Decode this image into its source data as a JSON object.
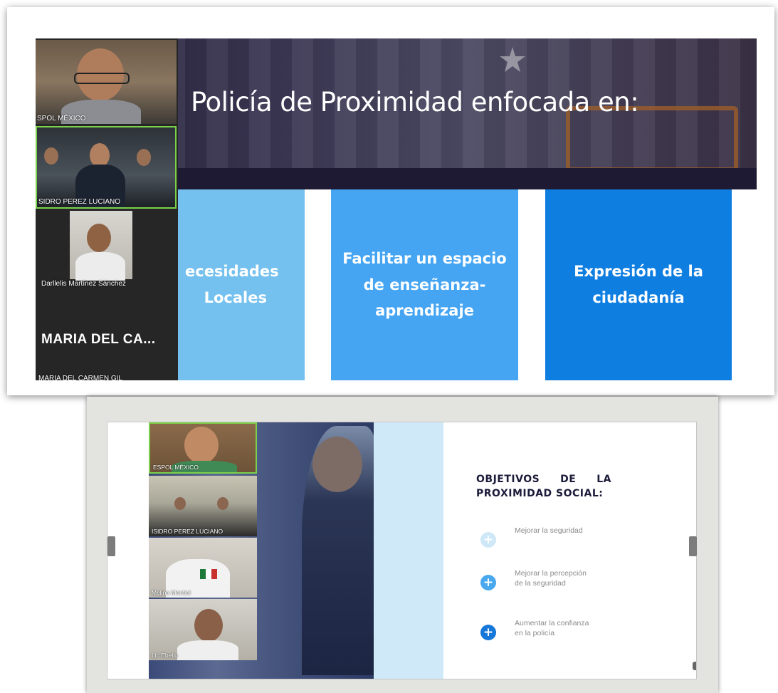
{
  "top_slide": {
    "title": "Policía de Proximidad enfocada en:",
    "cards": [
      {
        "line1": "ecesidades",
        "line2": "Locales",
        "color": "#74c0ee"
      },
      {
        "line1": "Facilitar un espacio",
        "line2": "de enseñanza-",
        "line3": "aprendizaje",
        "color": "#45a5f3"
      },
      {
        "line1": "Expresión de la",
        "line2": "ciudadanía",
        "color": "#0f7ee1"
      }
    ],
    "participants": [
      {
        "label": "SPOL MÉXICO"
      },
      {
        "label": "SIDRO PEREZ LUCIANO"
      },
      {
        "label": "Darllelis Martínez Sánchez"
      },
      {
        "name_display": "MARIA DEL CA...",
        "label": "MARIA DEL CARMEN GIL"
      }
    ]
  },
  "bottom_slide": {
    "title_line1": [
      "OBJETIVOS",
      "DE",
      "LA"
    ],
    "title_line2": "PROXIMIDAD SOCIAL:",
    "items": [
      {
        "text": "Mejorar la seguridad",
        "icon": "plus-circle-icon",
        "color": "#cfe8f8"
      },
      {
        "text": "Mejorar la percepción de la seguridad",
        "icon": "plus-circle-icon",
        "color": "#4aa8ee"
      },
      {
        "text": "Aumentar la confianza en la policía",
        "icon": "plus-circle-icon",
        "color": "#1677d8"
      }
    ],
    "participants": [
      {
        "label": "ESPOL MÉXICO"
      },
      {
        "label": "ISIDRO PEREZ LUCIANO"
      },
      {
        "label": "Melina Montiel"
      },
      {
        "label": "Lic Ebelio"
      }
    ]
  }
}
